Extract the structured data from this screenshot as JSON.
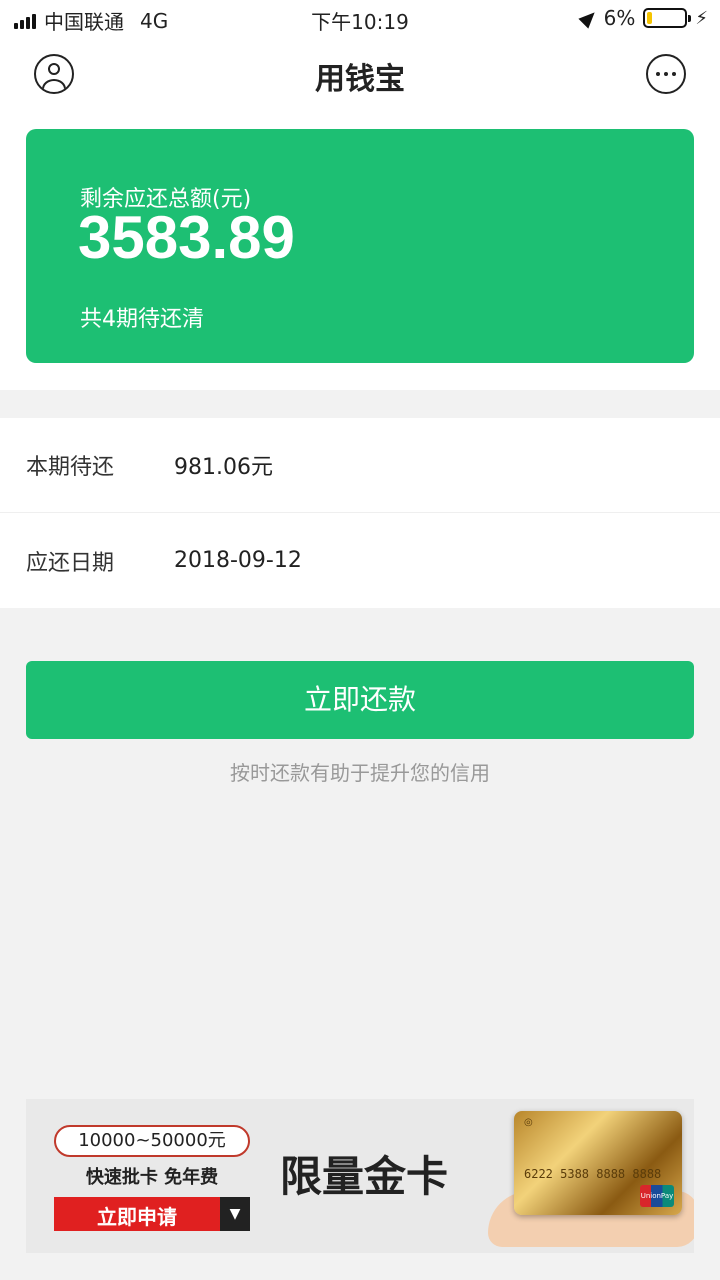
{
  "status_bar": {
    "carrier": "中国联通",
    "network": "4G",
    "time": "下午10:19",
    "battery_percent": "6%",
    "battery_level": 0.06
  },
  "nav": {
    "title": "用钱宝",
    "left_icon": "user-icon",
    "right_icon": "more-icon"
  },
  "summary": {
    "label": "剩余应还总额(元)",
    "amount": "3583.89",
    "periods": "共4期待还清",
    "color": "#1dbf73"
  },
  "details": [
    {
      "key": "本期待还",
      "value": "981.06元"
    },
    {
      "key": "应还日期",
      "value": "2018-09-12"
    }
  ],
  "action": {
    "button_label": "立即还款",
    "tip": "按时还款有助于提升您的信用"
  },
  "banner": {
    "range": "10000~50000元",
    "subtitle": "快速批卡  免年费",
    "apply_label": "立即申请",
    "headline": "限量金卡",
    "card_number": "6222 5388 8888 8888"
  }
}
